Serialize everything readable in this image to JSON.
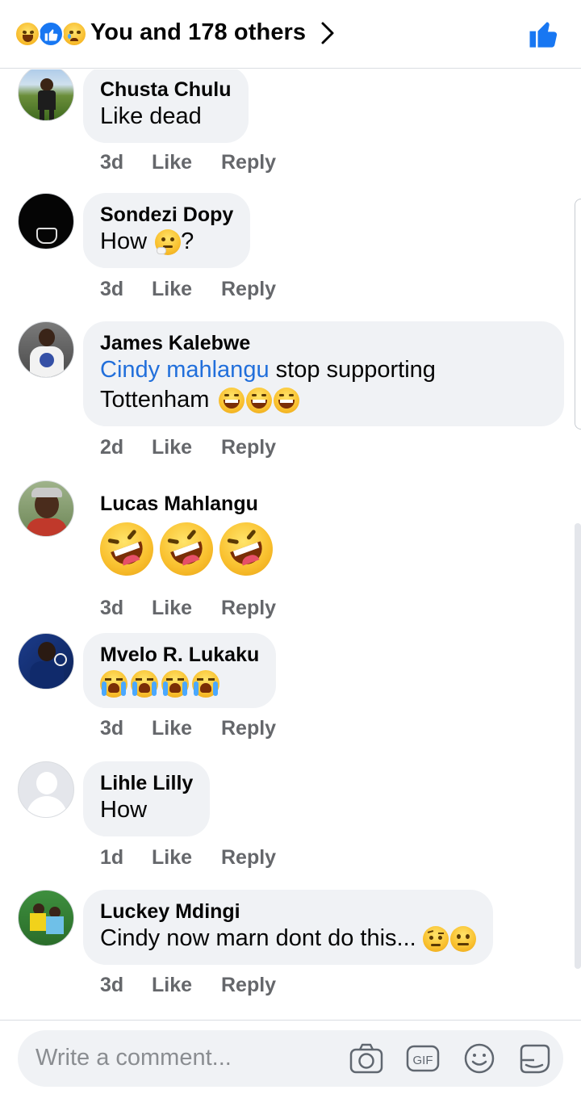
{
  "header": {
    "reactions": [
      "laugh-reaction",
      "like-reaction",
      "sad-reaction"
    ],
    "title": "You and 178 others",
    "chevron_icon": "chevron-right-icon",
    "like_icon": "thumbs-up-icon",
    "accent_color": "#1877f2"
  },
  "comments": [
    {
      "author": "Chusta Chulu",
      "text": "Like dead",
      "time": "3d",
      "like": "Like",
      "reply": "Reply"
    },
    {
      "author": "Sondezi Dopy",
      "text": "How",
      "text_suffix": "?",
      "emoji": [
        "thinking-face"
      ],
      "time": "3d",
      "like": "Like",
      "reply": "Reply"
    },
    {
      "author": "James Kalebwe",
      "mention": "Cindy mahlangu",
      "text": " stop supporting",
      "text_line2": "Tottenham",
      "emoji": [
        "joy-face",
        "joy-face",
        "joy-face"
      ],
      "time": "2d",
      "like": "Like",
      "reply": "Reply"
    },
    {
      "author": "Lucas Mahlangu",
      "emoji": [
        "rofl-face",
        "rofl-face",
        "rofl-face"
      ],
      "time": "3d",
      "like": "Like",
      "reply": "Reply"
    },
    {
      "author": "Mvelo R. Lukaku",
      "emoji": [
        "sob-face",
        "sob-face",
        "sob-face",
        "sob-face"
      ],
      "time": "3d",
      "like": "Like",
      "reply": "Reply"
    },
    {
      "author": "Lihle Lilly",
      "text": "How",
      "time": "1d",
      "like": "Like",
      "reply": "Reply"
    },
    {
      "author": "Luckey Mdingi",
      "text": "Cindy now marn dont do this...",
      "emoji": [
        "raised-eyebrow-face",
        "neutral-face"
      ],
      "time": "3d",
      "like": "Like",
      "reply": "Reply"
    }
  ],
  "composer": {
    "placeholder": "Write a comment...",
    "icons": [
      "camera-icon",
      "gif-icon",
      "emoji-icon",
      "sticker-icon"
    ]
  }
}
